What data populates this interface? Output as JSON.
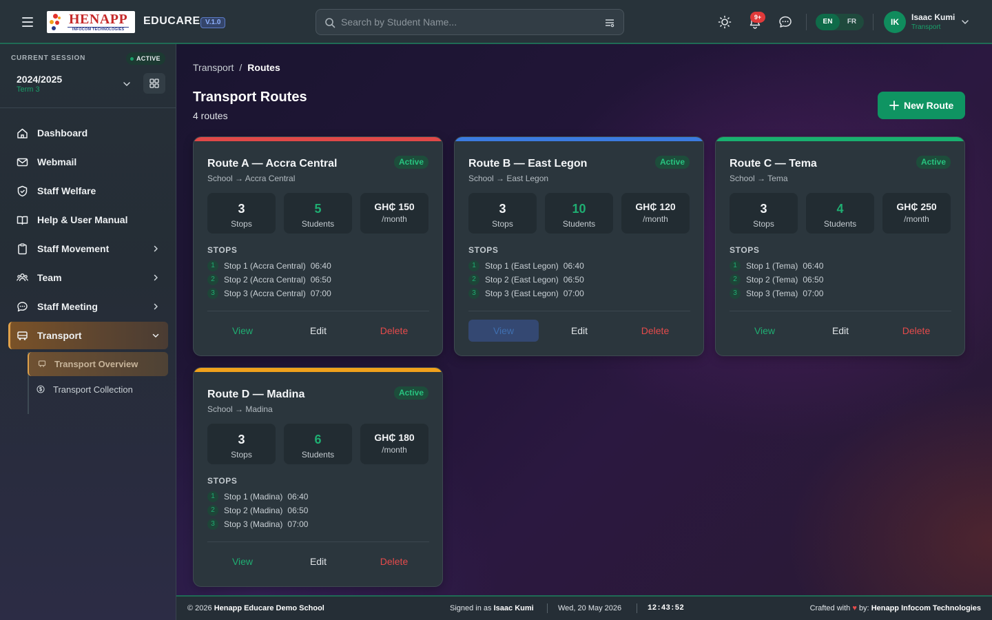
{
  "header": {
    "logo_main": "HENAPP",
    "logo_sub": "INFOCOM TECHNOLOGIES",
    "brand": "EDUCARE",
    "version": "V.1.0",
    "search_placeholder": "Search by Student Name...",
    "notification_count": "9+",
    "languages": [
      "EN",
      "FR"
    ],
    "user_initials": "IK",
    "user_name": "Isaac Kumi",
    "user_role": "Transport",
    "icons": [
      "menu-icon",
      "search-icon",
      "filter-icon",
      "sun-icon",
      "bell-icon",
      "chat-icon",
      "chevron-down-icon"
    ]
  },
  "session": {
    "label": "CURRENT SESSION",
    "status": "ACTIVE",
    "year": "2024/2025",
    "term": "Term 3"
  },
  "sidebar": {
    "items": [
      {
        "label": "Dashboard",
        "icon": "home-icon"
      },
      {
        "label": "Webmail",
        "icon": "mail-icon"
      },
      {
        "label": "Staff Welfare",
        "icon": "shield-icon"
      },
      {
        "label": "Help & User Manual",
        "icon": "book-icon"
      },
      {
        "label": "Staff Movement",
        "icon": "clipboard-icon"
      },
      {
        "label": "Team",
        "icon": "users-icon"
      },
      {
        "label": "Staff Meeting",
        "icon": "chat-icon"
      },
      {
        "label": "Transport",
        "icon": "bus-icon"
      }
    ],
    "sub_items": [
      {
        "label": "Transport Overview",
        "icon": "bus-icon"
      },
      {
        "label": "Transport Collection",
        "icon": "dollar-circle-icon"
      }
    ]
  },
  "page": {
    "breadcrumb_parent": "Transport",
    "breadcrumb_sep": "/",
    "breadcrumb_current": "Routes",
    "title": "Transport Routes",
    "subtitle": "4 routes",
    "new_button": "New Route",
    "stops_heading": "STOPS",
    "labels": {
      "stops": "Stops",
      "students": "Students",
      "per_month": "/month"
    },
    "actions": {
      "view": "View",
      "edit": "Edit",
      "delete": "Delete"
    }
  },
  "routes": [
    {
      "name": "Route A — Accra Central",
      "path": "School → Accra Central",
      "status": "Active",
      "accent": "#e04848",
      "stops_count": "3",
      "students": "5",
      "fee": "GH₵ 150",
      "stops": [
        {
          "n": "1",
          "name": "Stop 1 (Accra Central)",
          "time": "06:40"
        },
        {
          "n": "2",
          "name": "Stop 2 (Accra Central)",
          "time": "06:50"
        },
        {
          "n": "3",
          "name": "Stop 3 (Accra Central)",
          "time": "07:00"
        }
      ]
    },
    {
      "name": "Route B — East Legon",
      "path": "School → East Legon",
      "status": "Active",
      "accent": "#3b7be0",
      "stops_count": "3",
      "students": "10",
      "fee": "GH₵ 120",
      "stops": [
        {
          "n": "1",
          "name": "Stop 1 (East Legon)",
          "time": "06:40"
        },
        {
          "n": "2",
          "name": "Stop 2 (East Legon)",
          "time": "06:50"
        },
        {
          "n": "3",
          "name": "Stop 3 (East Legon)",
          "time": "07:00"
        }
      ]
    },
    {
      "name": "Route C — Tema",
      "path": "School → Tema",
      "status": "Active",
      "accent": "#19b070",
      "stops_count": "3",
      "students": "4",
      "fee": "GH₵ 250",
      "stops": [
        {
          "n": "1",
          "name": "Stop 1 (Tema)",
          "time": "06:40"
        },
        {
          "n": "2",
          "name": "Stop 2 (Tema)",
          "time": "06:50"
        },
        {
          "n": "3",
          "name": "Stop 3 (Tema)",
          "time": "07:00"
        }
      ]
    },
    {
      "name": "Route D — Madina",
      "path": "School → Madina",
      "status": "Active",
      "accent": "#f0a11c",
      "stops_count": "3",
      "students": "6",
      "fee": "GH₵ 180",
      "stops": [
        {
          "n": "1",
          "name": "Stop 1 (Madina)",
          "time": "06:40"
        },
        {
          "n": "2",
          "name": "Stop 2 (Madina)",
          "time": "06:50"
        },
        {
          "n": "3",
          "name": "Stop 3 (Madina)",
          "time": "07:00"
        }
      ]
    }
  ],
  "footer": {
    "copyright": "© 2026",
    "school": "Henapp Educare Demo School",
    "signed_in_prefix": "Signed in as",
    "signed_in_user": "Isaac Kumi",
    "date": "Wed, 20 May 2026",
    "time": "12:43:52",
    "crafted_prefix": "Crafted with",
    "heart": "♥",
    "crafted_mid": "by:",
    "company": "Henapp Infocom Technologies"
  },
  "colors": {
    "brand_green": "#0f9462",
    "active_nav": "#e0a14a",
    "delete_red": "#e54b4b"
  }
}
